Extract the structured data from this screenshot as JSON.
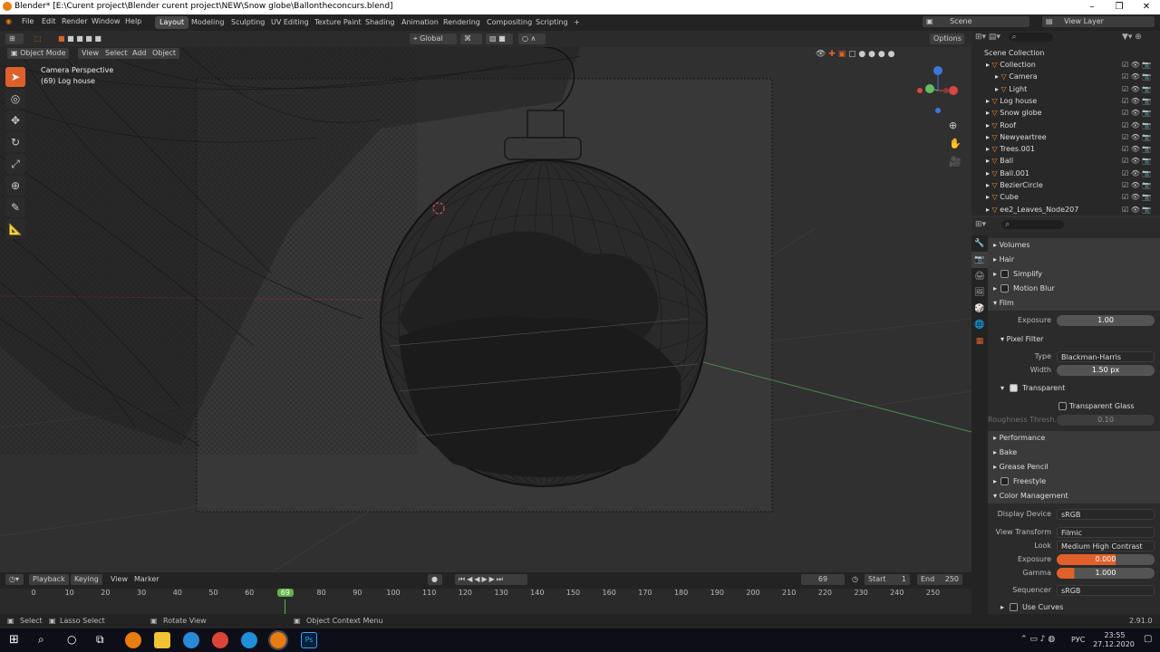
{
  "window": {
    "title": "Blender* [E:\\Curent project\\Blender curent project\\NEW\\Snow globe\\Ballontheconcurs.blend]"
  },
  "menu": {
    "items": [
      "File",
      "Edit",
      "Render",
      "Window",
      "Help"
    ]
  },
  "workspaces": [
    "Layout",
    "Modeling",
    "Sculpting",
    "UV Editing",
    "Texture Paint",
    "Shading",
    "Animation",
    "Rendering",
    "Compositing",
    "Scripting"
  ],
  "active_workspace": "Layout",
  "topright": {
    "scene": "Scene",
    "view_layer": "View Layer"
  },
  "header": {
    "mode": "Object Mode",
    "view": "View",
    "select": "Select",
    "add": "Add",
    "object": "Object",
    "orientation": "Global",
    "options": "Options"
  },
  "viewport": {
    "camera_label": "Camera Perspective",
    "object_label": "(69) Log house"
  },
  "outliner": {
    "root": "Scene Collection",
    "rows": [
      {
        "name": "Collection",
        "indent": 1
      },
      {
        "name": "Camera",
        "indent": 2
      },
      {
        "name": "Light",
        "indent": 2
      },
      {
        "name": "Log house",
        "indent": 1
      },
      {
        "name": "Snow globe",
        "indent": 1
      },
      {
        "name": "Roof",
        "indent": 1
      },
      {
        "name": "Newyeartree",
        "indent": 1
      },
      {
        "name": "Trees.001",
        "indent": 1
      },
      {
        "name": "Ball",
        "indent": 1
      },
      {
        "name": "Ball.001",
        "indent": 1
      },
      {
        "name": "BezierCircle",
        "indent": 1
      },
      {
        "name": "Cube",
        "indent": 1
      },
      {
        "name": "ee2_Leaves_Node207",
        "indent": 1
      }
    ]
  },
  "properties": {
    "sections": {
      "volumes": "Volumes",
      "hair": "Hair",
      "simplify": "Simplify",
      "motion_blur": "Motion Blur",
      "film": "Film",
      "pixel_filter": "Pixel Filter",
      "transparent": "Transparent",
      "transparent_glass": "Transparent Glass",
      "performance": "Performance",
      "bake": "Bake",
      "grease_pencil": "Grease Pencil",
      "freestyle": "Freestyle",
      "color_management": "Color Management",
      "use_curves": "Use Curves"
    },
    "fields": {
      "exposure_label": "Exposure",
      "exposure_value": "1.00",
      "type_label": "Type",
      "type_value": "Blackman-Harris",
      "width_label": "Width",
      "width_value": "1.50 px",
      "roughness_label": "Roughness Thresh...",
      "roughness_value": "0.10",
      "display_device_label": "Display Device",
      "display_device_value": "sRGB",
      "view_transform_label": "View Transform",
      "view_transform_value": "Filmic",
      "look_label": "Look",
      "look_value": "Medium High Contrast",
      "cm_exposure_label": "Exposure",
      "cm_exposure_value": "0.000",
      "gamma_label": "Gamma",
      "gamma_value": "1.000",
      "sequencer_label": "Sequencer",
      "sequencer_value": "sRGB"
    }
  },
  "timeline": {
    "playback": "Playback",
    "keying": "Keying",
    "view": "View",
    "marker": "Marker",
    "current_frame": "69",
    "start_label": "Start",
    "start": "1",
    "end_label": "End",
    "end": "250",
    "ticks": [
      "0",
      "10",
      "20",
      "30",
      "40",
      "50",
      "60",
      "69",
      "80",
      "90",
      "100",
      "110",
      "120",
      "130",
      "140",
      "150",
      "160",
      "170",
      "180",
      "190",
      "200",
      "210",
      "220",
      "230",
      "240",
      "250"
    ]
  },
  "status": {
    "select": "Select",
    "lasso": "Lasso Select",
    "rotate": "Rotate View",
    "context": "Object Context Menu",
    "version": "2.91.0"
  },
  "taskbar": {
    "lang": "РУС",
    "time": "23:55",
    "date": "27.12.2020"
  },
  "colors": {
    "accent": "#e0602c",
    "orange_icon": "#e8913a",
    "green_frame": "#5fb34a",
    "blender_orange": "#e87d0d"
  }
}
